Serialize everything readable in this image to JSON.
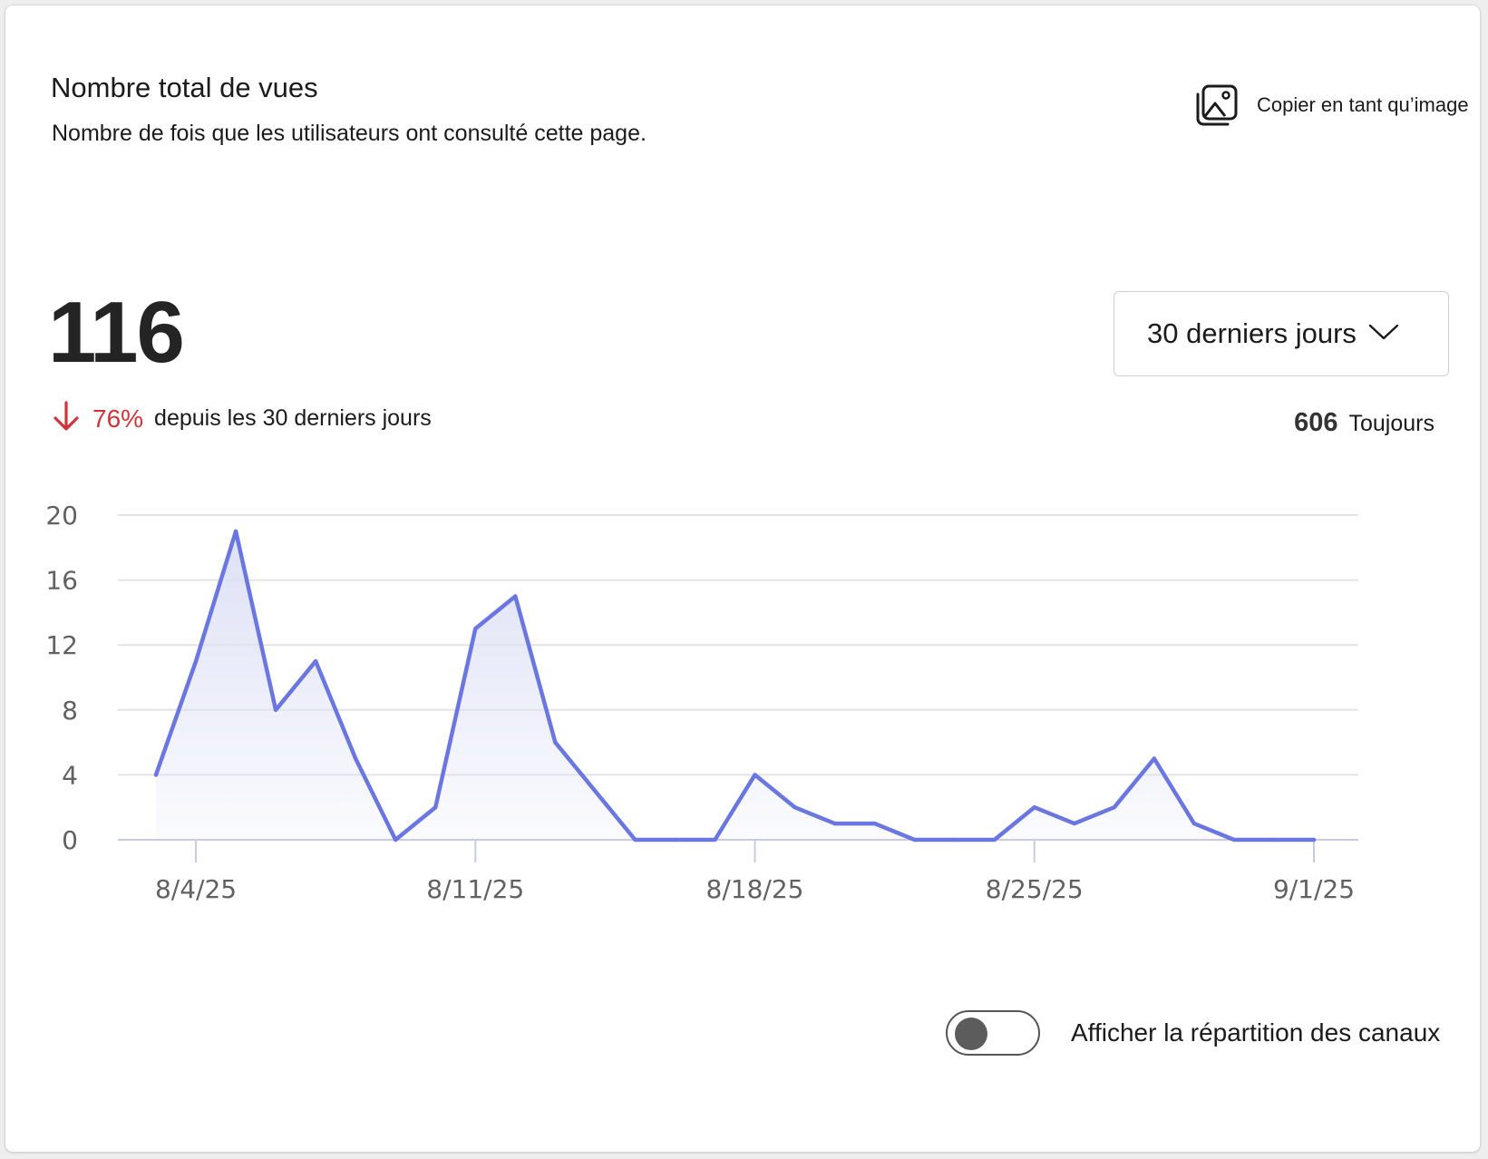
{
  "card": {
    "title": "Nombre total de vues",
    "subtitle": "Nombre de fois que les utilisateurs ont consulté cette page.",
    "copy_label": "Copier en tant qu’image",
    "total_value": "116",
    "change_percent": "76%",
    "change_text": "depuis les 30 derniers jours",
    "range_label": "30 derniers jours",
    "alltime_value": "606",
    "alltime_label": "Toujours",
    "toggle_label": "Afficher la répartition des canaux",
    "toggle_on": false
  },
  "colors": {
    "line": "#6b77e0",
    "fill_top": "#dcdff5",
    "grid": "#e4e4e4",
    "axis_text": "#616161",
    "decrease": "#d13438"
  },
  "icons": {
    "copy": "image-copy-icon",
    "arrow": "arrow-down-icon",
    "chevron": "chevron-down-icon"
  },
  "chart_data": {
    "type": "area",
    "x": [
      "8/3/25",
      "8/4/25",
      "8/5/25",
      "8/6/25",
      "8/7/25",
      "8/8/25",
      "8/9/25",
      "8/10/25",
      "8/11/25",
      "8/12/25",
      "8/13/25",
      "8/14/25",
      "8/15/25",
      "8/16/25",
      "8/17/25",
      "8/18/25",
      "8/19/25",
      "8/20/25",
      "8/21/25",
      "8/22/25",
      "8/23/25",
      "8/24/25",
      "8/25/25",
      "8/26/25",
      "8/27/25",
      "8/28/25",
      "8/29/25",
      "8/30/25",
      "8/31/25",
      "9/1/25"
    ],
    "values": [
      4,
      11,
      19,
      8,
      11,
      5,
      0,
      2,
      13,
      15,
      6,
      3,
      0,
      0,
      0,
      4,
      2,
      1,
      1,
      0,
      0,
      0,
      2,
      1,
      2,
      5,
      1,
      0,
      0,
      0
    ],
    "x_ticks": [
      "8/4/25",
      "8/11/25",
      "8/18/25",
      "8/25/25",
      "9/1/25"
    ],
    "y_ticks": [
      0,
      4,
      8,
      12,
      16,
      20
    ],
    "ylim": [
      0,
      20
    ],
    "grid": true,
    "title": "",
    "xlabel": "",
    "ylabel": ""
  }
}
